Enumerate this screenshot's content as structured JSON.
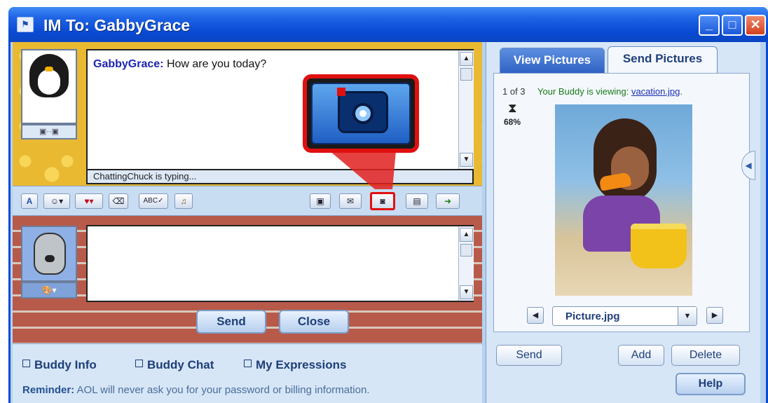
{
  "window": {
    "title": "IM To: GabbyGrace",
    "minimize_icon": "minimize-icon",
    "maximize_icon": "maximize-icon",
    "close_icon": "close-icon"
  },
  "conversation": {
    "sender": "GabbyGrace:",
    "message": "How are you today?",
    "typing_status": "ChattingChuck is typing..."
  },
  "toolbar": {
    "font_label": "A",
    "smiley_label": "☺▾",
    "heart_label": "♥▾",
    "clean_label": "⌫",
    "spell_label": "ABC✓",
    "music_label": "♫",
    "video_label": "▣",
    "voice_label": "✉",
    "camera_label": "◙",
    "film_label": "▤",
    "share_label": "➜"
  },
  "compose": {
    "send_label": "Send",
    "close_label": "Close"
  },
  "bottom_links": {
    "buddy_info": "Buddy Info",
    "buddy_chat": "Buddy Chat",
    "my_expressions": "My Expressions"
  },
  "reminder": {
    "label": "Reminder:",
    "text": "AOL will never ask you for your password or billing information."
  },
  "pictures_panel": {
    "tabs": [
      "View Pictures",
      "Send Pictures"
    ],
    "active_tab": "Send Pictures",
    "counter": "1 of 3",
    "viewing_prefix": "Your Buddy is viewing:",
    "viewing_file": "vacation.jpg",
    "viewing_suffix": ".",
    "progress": "68%",
    "progress_value": 0.68,
    "file_select": "Picture.jpg",
    "send_label": "Send",
    "add_label": "Add",
    "delete_label": "Delete",
    "help_label": "Help"
  },
  "colors": {
    "titlebar": "#0a4bd4",
    "callout_border": "#e01010",
    "link": "#1e3e78"
  }
}
